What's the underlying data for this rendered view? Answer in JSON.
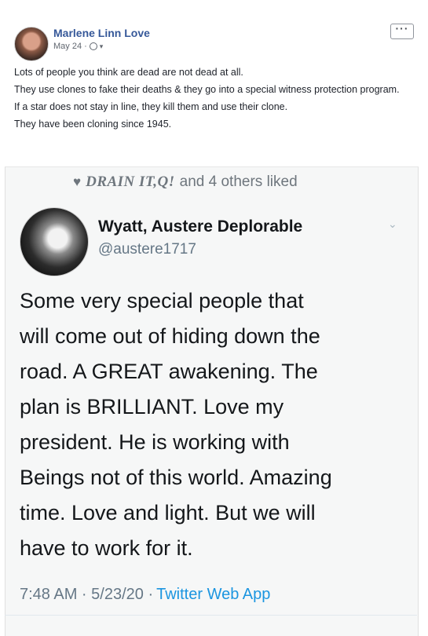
{
  "post": {
    "author": "Marlene Linn Love",
    "date": "May 24 ·",
    "more_label": "···",
    "paragraphs": [
      "Lots of people you think are dead are not dead at all.",
      "They use clones to fake their deaths & they go into a special witness protection program.",
      "If a star does not stay in line, they kill them and use their clone.",
      "They have been cloning since 1945."
    ]
  },
  "tweet": {
    "liked_icon": "heart-icon",
    "liked_name": "DRAIN IT,Q!",
    "liked_rest": "and 4 others liked",
    "name": "Wyatt, Austere Deplorable",
    "handle": "@austere1717",
    "body_lines": [
      "Some very special people that",
      "will come out of hiding down the",
      "road. A GREAT awakening. The",
      "plan is BRILLIANT. Love my",
      "president. He is working with",
      "Beings not of this world. Amazing",
      "time. Love and light. But we will",
      "have to work for it."
    ],
    "time": "7:48 AM · 5/23/20 ·",
    "source": "Twitter Web App"
  },
  "colors": {
    "link_blue": "#365899",
    "twitter_blue": "#1b95e0",
    "meta_gray": "#616770"
  }
}
